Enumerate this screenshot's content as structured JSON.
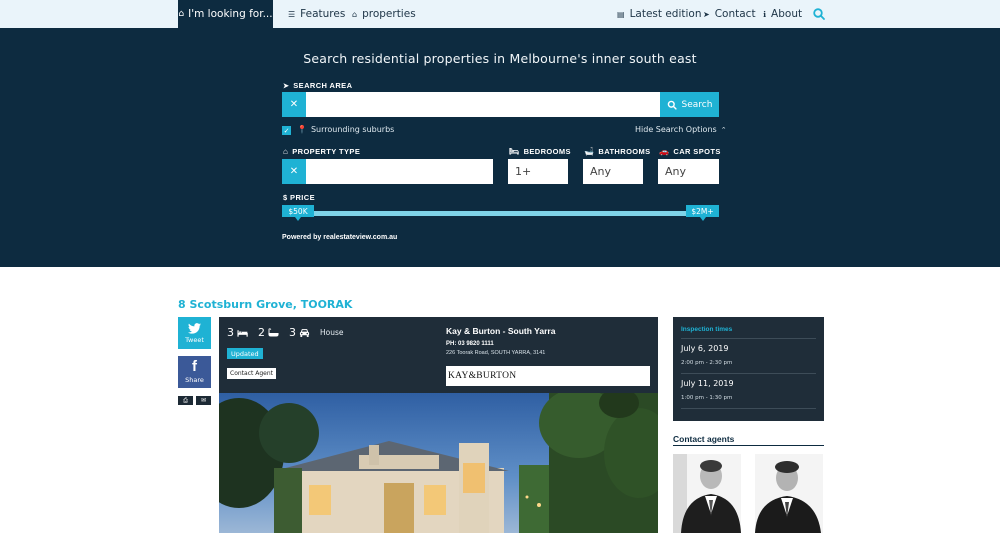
{
  "nav": {
    "looking_for": "I'm looking for...",
    "features": "Features",
    "properties": "properties",
    "latest_edition": "Latest edition",
    "contact": "Contact",
    "about": "About"
  },
  "search": {
    "title": "Search residential properties in Melbourne's inner south east",
    "area_label": "SEARCH AREA",
    "search_button": "Search",
    "surrounding_suburbs": "Surrounding suburbs",
    "hide_options": "Hide Search Options",
    "property_type_label": "PROPERTY TYPE",
    "bedrooms_label": "BEDROOMS",
    "bathrooms_label": "BATHROOMS",
    "car_spots_label": "CAR SPOTS",
    "bedrooms_value": "1+",
    "bathrooms_value": "Any",
    "car_spots_value": "Any",
    "price_label": "$ PRICE",
    "price_min": "$50K",
    "price_max": "$2M+",
    "powered_by": "Powered by realestateview.com.au"
  },
  "listing": {
    "title": "8 Scotsburn Grove, TOORAK",
    "bedrooms": "3",
    "bathrooms": "2",
    "car_spots": "3",
    "property_type": "House",
    "status_badge": "Updated",
    "contact_agent": "Contact Agent",
    "agency_name": "Kay & Burton - South Yarra",
    "agency_phone": "PH: 03 9820 1111",
    "agency_address": "226 Toorak Road, SOUTH YARRA, 3141",
    "agency_logo": "KAY&BURTON"
  },
  "share": {
    "tweet": "Tweet",
    "share": "Share"
  },
  "inspection": {
    "title": "Inspection times",
    "times": [
      {
        "date": "July 6, 2019",
        "time": "2:00 pm - 2:30 pm"
      },
      {
        "date": "July 11, 2019",
        "time": "1:00 pm - 1:30 pm"
      }
    ]
  },
  "agents": {
    "title": "Contact agents"
  },
  "colors": {
    "navy": "#0d2b40",
    "accent": "#1fb2d4",
    "panel": "#1f2d39"
  }
}
